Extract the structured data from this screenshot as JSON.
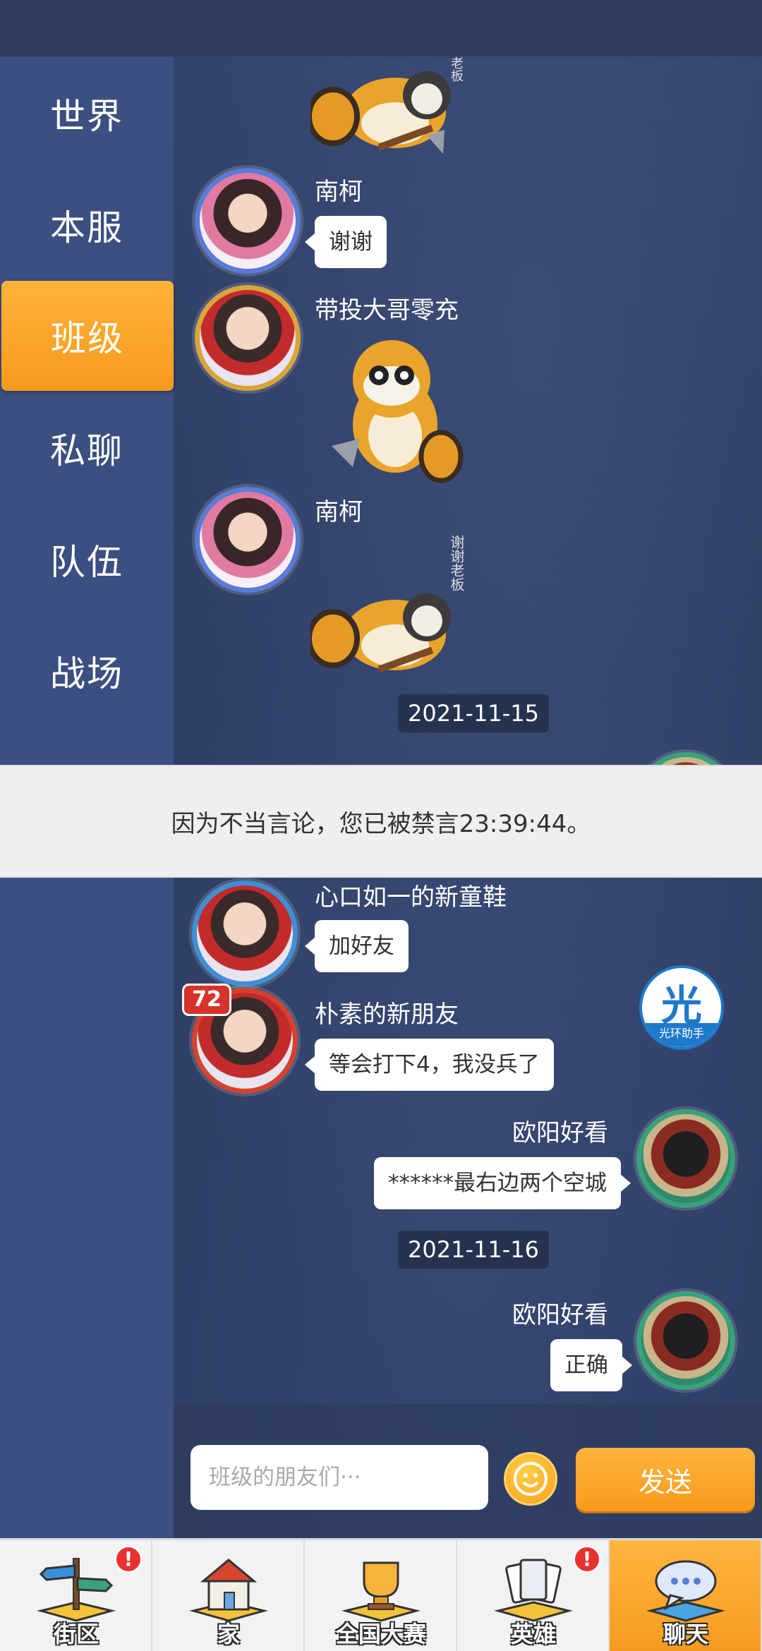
{
  "sidebar": {
    "items": [
      {
        "label": "世界"
      },
      {
        "label": "本服"
      },
      {
        "label": "班级"
      },
      {
        "label": "私聊"
      },
      {
        "label": "队伍"
      },
      {
        "label": "战场"
      }
    ],
    "active_index": 2
  },
  "chat": {
    "sticker_text_top": "老板",
    "messages_before": [
      {
        "name": "南柯",
        "text": "谢谢"
      },
      {
        "name": "带投大哥零充",
        "text": ""
      },
      {
        "name": "南柯",
        "text": "",
        "sticker_text": "谢谢老板"
      }
    ],
    "date_1": "2021-11-15",
    "messages_after": [
      {
        "name": "心口如一的新童鞋",
        "text": "加好友"
      },
      {
        "name": "朴素的新朋友",
        "text": "等会打下4，我没兵了"
      },
      {
        "name": "欧阳好看",
        "text": "******最右边两个空城"
      }
    ],
    "date_2": "2021-11-16",
    "last_message": {
      "name": "欧阳好看",
      "text": "正确"
    },
    "avatar_badge_text": "72"
  },
  "toast": {
    "text": "因为不当言论，您已被禁言23:39:44。"
  },
  "assistant": {
    "glyph": "光",
    "label": "光环助手"
  },
  "input": {
    "placeholder": "班级的朋友们···",
    "send_label": "发送"
  },
  "bottom_nav": [
    {
      "label": "街区",
      "badge": "!"
    },
    {
      "label": "家",
      "badge": ""
    },
    {
      "label": "全国大赛",
      "badge": ""
    },
    {
      "label": "英雄",
      "badge": "!"
    },
    {
      "label": "聊天",
      "badge": ""
    }
  ],
  "colors": {
    "accent": "#f79a1e",
    "sidebar": "#3b4f80",
    "bubble": "#ffffff"
  }
}
